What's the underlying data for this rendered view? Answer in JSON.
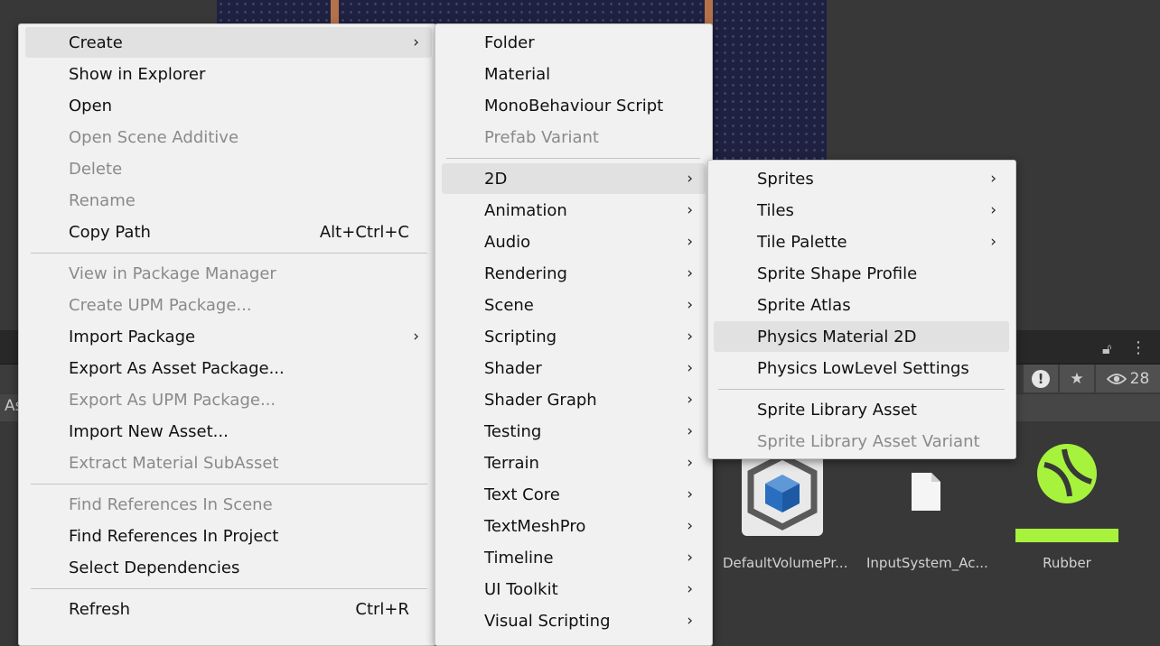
{
  "background": {
    "left_label": "As",
    "filter_count": "28",
    "assets": [
      {
        "label": "DefaultVolumePr..."
      },
      {
        "label": "InputSystem_Ac..."
      },
      {
        "label": "Rubber"
      }
    ]
  },
  "context_menu": {
    "items": [
      {
        "label": "Create",
        "submenu": true,
        "highlighted": true
      },
      {
        "label": "Show in Explorer"
      },
      {
        "label": "Open"
      },
      {
        "label": "Open Scene Additive",
        "disabled": true
      },
      {
        "label": "Delete",
        "disabled": true
      },
      {
        "label": "Rename",
        "disabled": true
      },
      {
        "label": "Copy Path",
        "shortcut": "Alt+Ctrl+C"
      },
      {
        "label": "View in Package Manager",
        "disabled": true
      },
      {
        "label": "Create UPM Package...",
        "disabled": true
      },
      {
        "label": "Import Package",
        "submenu": true
      },
      {
        "label": "Export As Asset Package..."
      },
      {
        "label": "Export As UPM Package...",
        "disabled": true
      },
      {
        "label": "Import New Asset..."
      },
      {
        "label": "Extract Material SubAsset",
        "disabled": true
      },
      {
        "label": "Find References In Scene",
        "disabled": true
      },
      {
        "label": "Find References In Project"
      },
      {
        "label": "Select Dependencies"
      },
      {
        "label": "Refresh",
        "shortcut": "Ctrl+R"
      }
    ]
  },
  "create_menu": {
    "items": [
      {
        "label": "Folder"
      },
      {
        "label": "Material"
      },
      {
        "label": "MonoBehaviour Script"
      },
      {
        "label": "Prefab Variant",
        "disabled": true
      },
      {
        "label": "2D",
        "submenu": true,
        "highlighted": true
      },
      {
        "label": "Animation",
        "submenu": true
      },
      {
        "label": "Audio",
        "submenu": true
      },
      {
        "label": "Rendering",
        "submenu": true
      },
      {
        "label": "Scene",
        "submenu": true
      },
      {
        "label": "Scripting",
        "submenu": true
      },
      {
        "label": "Shader",
        "submenu": true
      },
      {
        "label": "Shader Graph",
        "submenu": true
      },
      {
        "label": "Testing",
        "submenu": true
      },
      {
        "label": "Terrain",
        "submenu": true
      },
      {
        "label": "Text Core",
        "submenu": true
      },
      {
        "label": "TextMeshPro",
        "submenu": true
      },
      {
        "label": "Timeline",
        "submenu": true
      },
      {
        "label": "UI Toolkit",
        "submenu": true
      },
      {
        "label": "Visual Scripting",
        "submenu": true
      }
    ]
  },
  "menu_2d": {
    "items": [
      {
        "label": "Sprites",
        "submenu": true
      },
      {
        "label": "Tiles",
        "submenu": true
      },
      {
        "label": "Tile Palette",
        "submenu": true
      },
      {
        "label": "Sprite Shape Profile"
      },
      {
        "label": "Sprite Atlas"
      },
      {
        "label": "Physics Material 2D",
        "highlighted": true
      },
      {
        "label": "Physics LowLevel Settings"
      },
      {
        "label": "Sprite Library Asset"
      },
      {
        "label": "Sprite Library Asset Variant",
        "disabled": true
      }
    ]
  },
  "colors": {
    "menu_bg": "#f1f1f1",
    "highlight": "#e1e1e1",
    "disabled_text": "#8a8a8a",
    "rubber_green": "#a6f23c",
    "scene_bg": "#1f2140"
  },
  "icons": {
    "submenu": "chevron-right-icon",
    "lock": "lock-icon",
    "more": "more-vertical-icon",
    "warning": "warning-icon",
    "favorite": "star-icon",
    "visibility": "eye-icon"
  }
}
